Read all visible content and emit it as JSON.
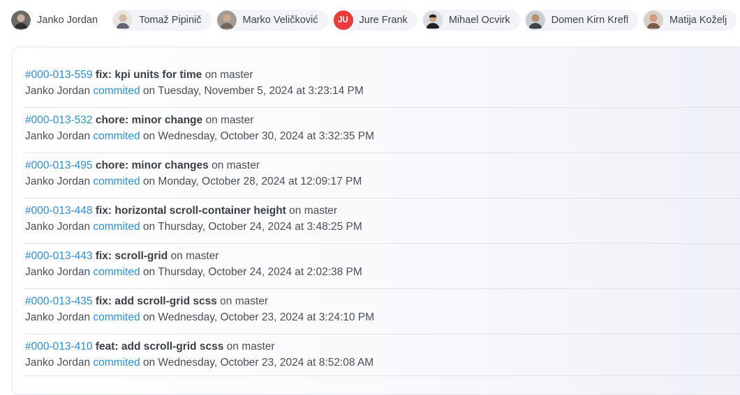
{
  "contributors": [
    {
      "name": "Janko Jordan",
      "avatar": "photo",
      "tone": "#6b6b66"
    },
    {
      "name": "Tomaž Pipinič",
      "avatar": "photo",
      "tone": "#c9b7a7"
    },
    {
      "name": "Marko Veličković",
      "avatar": "photo",
      "tone": "#8a7d70"
    },
    {
      "name": "Jure Frank",
      "avatar": "initials",
      "initials": "JU",
      "tone": "#ea3c3c"
    },
    {
      "name": "Mihael Ocvirk",
      "avatar": "photo",
      "tone": "#3a3f46"
    },
    {
      "name": "Domen Kirn Krefl",
      "avatar": "photo",
      "tone": "#4d5560"
    },
    {
      "name": "Matija Koželj",
      "avatar": "photo",
      "tone": "#b08a72"
    }
  ],
  "commits": [
    {
      "hash": "#000-013-559",
      "message": "fix: kpi units for time",
      "on": "on master",
      "author": "Janko Jordan",
      "action": "commited",
      "date": "on Tuesday, November 5, 2024 at 3:23:14 PM"
    },
    {
      "hash": "#000-013-532",
      "message": "chore: minor change",
      "on": "on master",
      "author": "Janko Jordan",
      "action": "commited",
      "date": "on Wednesday, October 30, 2024 at 3:32:35 PM"
    },
    {
      "hash": "#000-013-495",
      "message": "chore: minor changes",
      "on": "on master",
      "author": "Janko Jordan",
      "action": "commited",
      "date": "on Monday, October 28, 2024 at 12:09:17 PM"
    },
    {
      "hash": "#000-013-448",
      "message": "fix: horizontal scroll-container height",
      "on": "on master",
      "author": "Janko Jordan",
      "action": "commited",
      "date": "on Thursday, October 24, 2024 at 3:48:25 PM"
    },
    {
      "hash": "#000-013-443",
      "message": "fix: scroll-grid",
      "on": "on master",
      "author": "Janko Jordan",
      "action": "commited",
      "date": "on Thursday, October 24, 2024 at 2:02:38 PM"
    },
    {
      "hash": "#000-013-435",
      "message": "fix: add scroll-grid scss",
      "on": "on master",
      "author": "Janko Jordan",
      "action": "commited",
      "date": "on Wednesday, October 23, 2024 at 3:24:10 PM"
    },
    {
      "hash": "#000-013-410",
      "message": "feat: add scroll-grid scss",
      "on": "on master",
      "author": "Janko Jordan",
      "action": "commited",
      "date": "on Wednesday, October 23, 2024 at 8:52:08 AM"
    }
  ],
  "colors": {
    "link": "#2b8fd6",
    "initials_bg": "#ea3c3c",
    "divider": "#dfe2e7"
  }
}
